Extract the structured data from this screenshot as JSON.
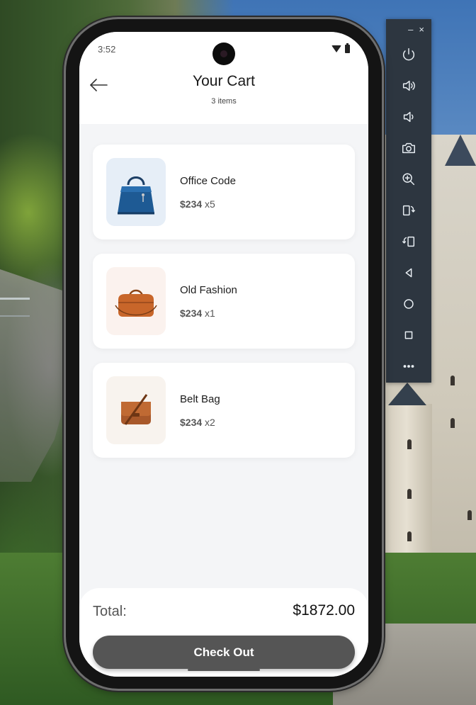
{
  "status": {
    "time": "3:52"
  },
  "header": {
    "title": "Your Cart",
    "subtitle": "3 items"
  },
  "cart": {
    "items": [
      {
        "name": "Office Code",
        "price": "$234",
        "qty": "x5",
        "thumb_bg": "#e6eef7",
        "icon": "blue-handbag-icon"
      },
      {
        "name": "Old Fashion",
        "price": "$234",
        "qty": "x1",
        "thumb_bg": "#fbf2ee",
        "icon": "brown-duffel-bag-icon"
      },
      {
        "name": "Belt Bag",
        "price": "$234",
        "qty": "x2",
        "thumb_bg": "#f8f3ee",
        "icon": "leather-messenger-bag-icon"
      }
    ]
  },
  "summary": {
    "total_label": "Total:",
    "total_value": "$1872.00",
    "checkout_label": "Check Out"
  },
  "colors": {
    "checkout_bg": "#555555",
    "screen_bg": "#f4f5f7"
  },
  "emulator_toolbar": {
    "minimize": "–",
    "close": "×",
    "buttons": [
      "power-icon",
      "volume-up-icon",
      "volume-down-icon",
      "camera-icon",
      "zoom-in-icon",
      "rotate-left-icon",
      "rotate-right-icon",
      "back-triangle-icon",
      "home-circle-icon",
      "overview-square-icon",
      "more-icon"
    ]
  }
}
